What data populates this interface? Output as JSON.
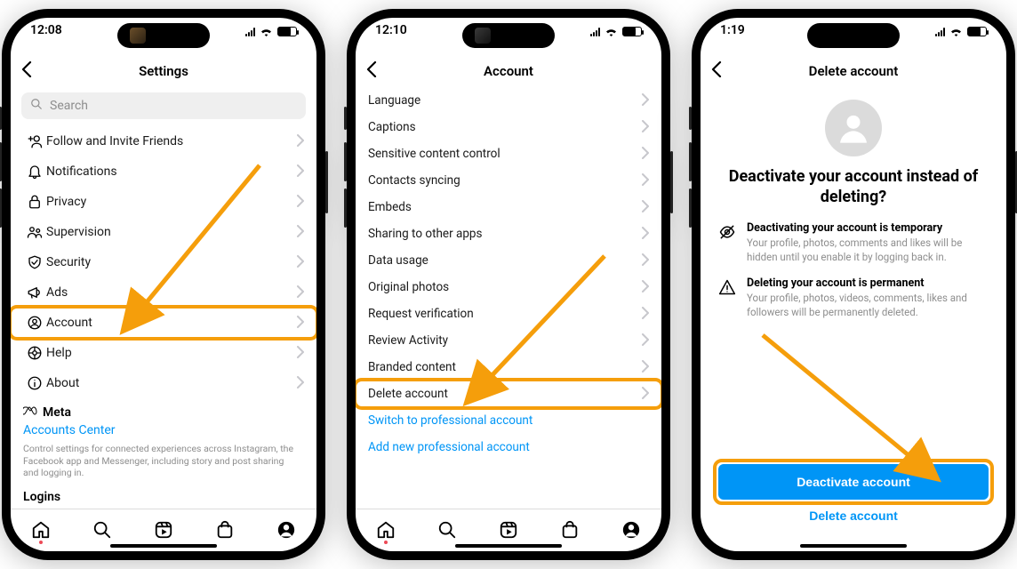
{
  "phone1": {
    "time": "12:08",
    "title": "Settings",
    "search_placeholder": "Search",
    "items": [
      {
        "label": "Follow and Invite Friends",
        "icon": "add-user"
      },
      {
        "label": "Notifications",
        "icon": "bell"
      },
      {
        "label": "Privacy",
        "icon": "lock"
      },
      {
        "label": "Supervision",
        "icon": "supervision"
      },
      {
        "label": "Security",
        "icon": "shield"
      },
      {
        "label": "Ads",
        "icon": "megaphone"
      },
      {
        "label": "Account",
        "icon": "account",
        "highlight": true
      },
      {
        "label": "Help",
        "icon": "help"
      },
      {
        "label": "About",
        "icon": "info"
      }
    ],
    "meta_brand": "Meta",
    "accounts_center": "Accounts Center",
    "fine_print": "Control settings for connected experiences across Instagram, the Facebook app and Messenger, including story and post sharing and logging in.",
    "logins": "Logins"
  },
  "phone2": {
    "time": "12:10",
    "title": "Account",
    "items": [
      {
        "label": "Language"
      },
      {
        "label": "Captions"
      },
      {
        "label": "Sensitive content control"
      },
      {
        "label": "Contacts syncing"
      },
      {
        "label": "Embeds"
      },
      {
        "label": "Sharing to other apps"
      },
      {
        "label": "Data usage"
      },
      {
        "label": "Original photos"
      },
      {
        "label": "Request verification"
      },
      {
        "label": "Review Activity"
      },
      {
        "label": "Branded content"
      },
      {
        "label": "Delete account",
        "highlight": true
      }
    ],
    "links": [
      "Switch to professional account",
      "Add new professional account"
    ]
  },
  "phone3": {
    "time": "1:19",
    "title": "Delete account",
    "headline": "Deactivate your account instead of deleting?",
    "blocks": [
      {
        "icon": "eye-off",
        "head": "Deactivating your account is temporary",
        "body": "Your profile, photos, comments and likes will be hidden until you enable it by logging back in."
      },
      {
        "icon": "warn",
        "head": "Deleting your account is permanent",
        "body": "Your profile, photos, videos, comments, likes and followers will be permanently deleted."
      }
    ],
    "primary": "Deactivate account",
    "secondary": "Delete account"
  }
}
